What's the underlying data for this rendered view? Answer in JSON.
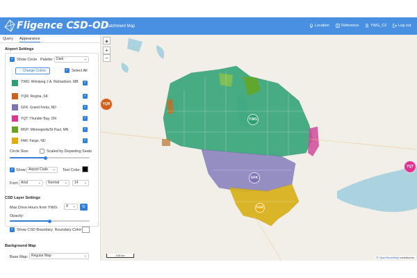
{
  "header": {
    "brand": "Fligence CSD-OD",
    "subtitle": "Catchment Map",
    "nav": [
      {
        "label": "Location",
        "icon": "pin-icon"
      },
      {
        "label": "Reference",
        "icon": "book-icon"
      },
      {
        "label": "YWG_CZ",
        "icon": "user-icon"
      },
      {
        "label": "Log out",
        "icon": "logout-icon"
      }
    ],
    "color": "#4a90e2"
  },
  "tabs": [
    "Query",
    "Appearance"
  ],
  "active_tab": "Appearance",
  "airport_settings": {
    "title": "Airport Settings",
    "show_circle_label": "Show Circle",
    "show_circle_checked": true,
    "palette_label": "Palette:",
    "palette_value": "Dark",
    "change_colors_label": "Change Colors",
    "select_all_label": "Select All",
    "select_all_checked": true,
    "airports": [
      {
        "label": "YWG: Winnipeg J.A. Richardson, MB",
        "color": "#2e9e73",
        "checked": true
      },
      {
        "label": "YQR: Regina, SK",
        "color": "#d2601a",
        "checked": true
      },
      {
        "label": "GFK: Grand Forks, ND",
        "color": "#7f73b6",
        "checked": true
      },
      {
        "label": "YQT: Thunder Bay, ON",
        "color": "#e0348f",
        "checked": true
      },
      {
        "label": "MSP: Minneapolis/St Paul, MN",
        "color": "#66a61e",
        "checked": true
      },
      {
        "label": "FAR: Fargo, ND",
        "color": "#e6ab02",
        "checked": true
      }
    ],
    "circle_size_label": "Circle Size:",
    "scaled_label": "Scaled by Departing Seats",
    "scaled_checked": false,
    "circle_size_level": 0.45,
    "show_label": "Show",
    "show_checked": true,
    "label_type": "Airport Code",
    "text_color_label": "Text Color:",
    "text_color": "#000000",
    "font_label": "Font:",
    "font_value": "Arial",
    "font_weight": "Normal",
    "font_size": "14"
  },
  "csd_settings": {
    "title": "CSD Layer Settings",
    "max_drive_label": "Max Drive Hours from YWG:",
    "max_drive_value": "4",
    "opacity_label": "Opacity:",
    "opacity_level": 0.5,
    "show_boundary_label": "Show CSD Boundary",
    "show_boundary_checked": true,
    "boundary_color_label": "Boundary Color:"
  },
  "background_map": {
    "title": "Background Map",
    "base_map_label": "Base Map:",
    "base_map_value": "Regular Map"
  },
  "map": {
    "zoom_in": "+",
    "zoom_out": "−",
    "scale_label": "100 km",
    "attribution_prefix": "© ",
    "attribution_link": "OpenStreetMap",
    "attribution_suffix": " contributors",
    "markers": [
      {
        "code": "YQR",
        "color": "#d2601a"
      },
      {
        "code": "YWG",
        "color": "#2e9e73"
      },
      {
        "code": "GFK",
        "color": "#7f73b6"
      },
      {
        "code": "FAR",
        "color": "#e6ab02"
      },
      {
        "code": "YQT",
        "color": "#e0348f"
      }
    ]
  }
}
